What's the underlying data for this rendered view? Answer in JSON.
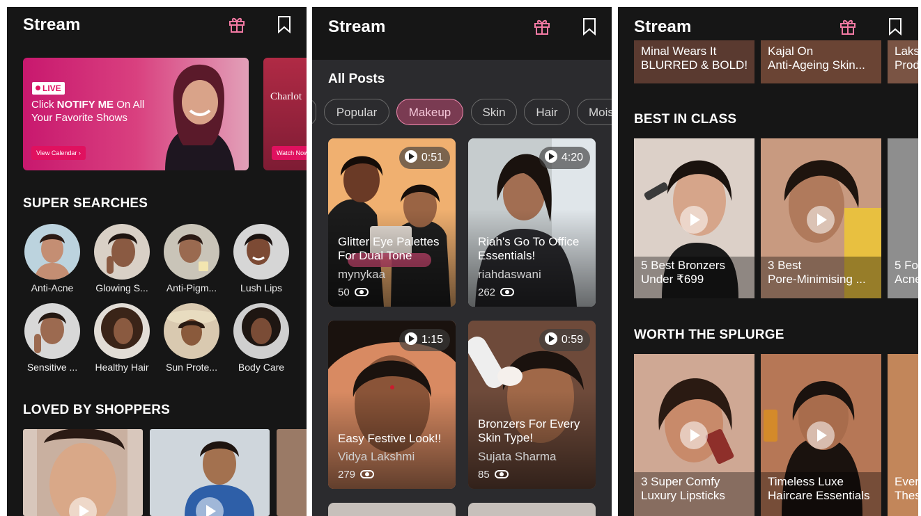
{
  "app": {
    "title": "Stream"
  },
  "panel1": {
    "promo": {
      "live": "LIVE",
      "text_a": "Click ",
      "text_b": "NOTIFY ME",
      "text_c": " On All Your Favorite Shows",
      "button": "View Calendar ›",
      "second_brand": "Charlot",
      "second_button": "Watch Now"
    },
    "super_searches": {
      "title": "SUPER SEARCHES",
      "items": [
        {
          "label": "Anti-Acne"
        },
        {
          "label": "Glowing S..."
        },
        {
          "label": "Anti-Pigm..."
        },
        {
          "label": "Lush Lips"
        },
        {
          "label": "Sensitive ..."
        },
        {
          "label": "Healthy Hair"
        },
        {
          "label": "Sun Prote..."
        },
        {
          "label": "Body Care"
        }
      ]
    },
    "loved": {
      "title": "LOVED BY SHOPPERS"
    }
  },
  "panel2": {
    "all_posts": "All Posts",
    "chips": [
      "Popular",
      "Makeup",
      "Skin",
      "Hair",
      "Mois"
    ],
    "active_chip": "Makeup",
    "posts": [
      {
        "duration": "0:51",
        "title_1": "Glitter Eye Palettes",
        "title_2": "For Dual Tone",
        "author": "mynykaa",
        "views": "50"
      },
      {
        "duration": "4:20",
        "title_1": "Riah's Go To Office",
        "title_2": "Essentials!",
        "author": "riahdaswani",
        "views": "262"
      },
      {
        "duration": "1:15",
        "title_1": "Easy Festive Look!!",
        "title_2": "",
        "author": "Vidya Lakshmi",
        "views": "279"
      },
      {
        "duration": "0:59",
        "title_1": "Bronzers For Every",
        "title_2": "Skin Type!",
        "author": "Sujata Sharma",
        "views": "85"
      }
    ]
  },
  "panel3": {
    "top_row": [
      {
        "line1": "Minal Wears It",
        "line2": "BLURRED & BOLD!"
      },
      {
        "line1": "Kajal On",
        "line2": "Anti-Ageing Skin..."
      },
      {
        "line1": "Laks",
        "line2": "Prod"
      }
    ],
    "best": {
      "title": "BEST IN CLASS",
      "items": [
        {
          "line1": "5 Best Bronzers",
          "line2": "Under ₹699"
        },
        {
          "line1": "3 Best",
          "line2": "Pore-Minimising ..."
        },
        {
          "line1": "5 Fo",
          "line2": "Acne"
        }
      ]
    },
    "splurge": {
      "title": "WORTH THE SPLURGE",
      "items": [
        {
          "line1": "3 Super Comfy",
          "line2": "Luxury Lipsticks"
        },
        {
          "line1": "Timeless Luxe",
          "line2": "Haircare Essentials"
        },
        {
          "line1": "Ever",
          "line2": "Thes"
        }
      ]
    }
  },
  "colors": {
    "accent": "#e0115f",
    "gift": "#f47aa4",
    "chip_active": "#f08ab0"
  }
}
